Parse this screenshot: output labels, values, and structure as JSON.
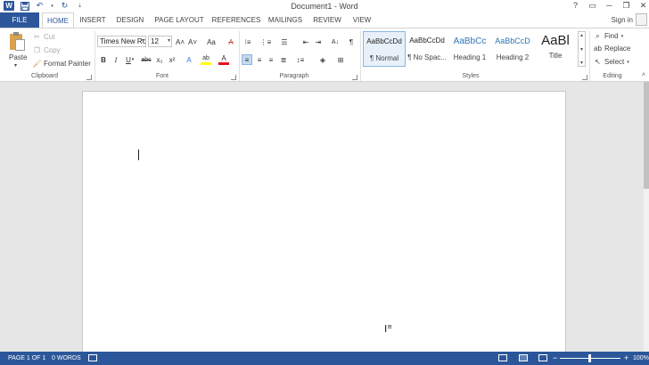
{
  "window": {
    "title": "Document1 - Word",
    "controls": [
      "?",
      "▭",
      "─",
      "❐",
      "✕"
    ]
  },
  "qat": {
    "app_icon": "W",
    "icons": [
      "word-logo-icon",
      "save-icon",
      "undo-icon",
      "redo-icon",
      "customize-qat-icon"
    ]
  },
  "tabs": [
    {
      "label": "FILE"
    },
    {
      "label": "HOME"
    },
    {
      "label": "INSERT"
    },
    {
      "label": "DESIGN"
    },
    {
      "label": "PAGE LAYOUT"
    },
    {
      "label": "REFERENCES"
    },
    {
      "label": "MAILINGS"
    },
    {
      "label": "REVIEW"
    },
    {
      "label": "VIEW"
    }
  ],
  "account": {
    "signin": "Sign in"
  },
  "clipboard": {
    "paste": "Paste",
    "cut": "Cut",
    "copy": "Copy",
    "format_painter": "Format Painter",
    "group_label": "Clipboard"
  },
  "font": {
    "family": "Times New Ro",
    "size": "12",
    "group_label": "Font",
    "grow": "A˄",
    "shrink": "A˅",
    "change_case": "Aa",
    "clear_format": "A",
    "bold": "B",
    "italic": "I",
    "underline": "U",
    "strike": "abc",
    "subscript": "x₂",
    "superscript": "x²",
    "text_effects": "A",
    "highlight": "ab",
    "font_color": "A"
  },
  "paragraph": {
    "group_label": "Paragraph",
    "show_marks": "¶",
    "sort": "A↓"
  },
  "styles": {
    "group_label": "Styles",
    "items": [
      {
        "sample": "AaBbCcDd",
        "name": "¶ Normal"
      },
      {
        "sample": "AaBbCcDd",
        "name": "¶ No Spac..."
      },
      {
        "sample": "AaBbCc",
        "name": "Heading 1"
      },
      {
        "sample": "AaBbCcD",
        "name": "Heading 2"
      },
      {
        "sample": "AaBl",
        "name": "Title"
      }
    ]
  },
  "editing": {
    "find": "Find",
    "replace": "Replace",
    "select": "Select",
    "group_label": "Editing"
  },
  "status": {
    "page": "PAGE 1 OF 1",
    "words": "0 WORDS",
    "zoom": "100%",
    "zoom_level": 1.0
  },
  "colors": {
    "accent": "#2b579a",
    "highlight": "#ffff00",
    "font_color": "#e81123"
  }
}
